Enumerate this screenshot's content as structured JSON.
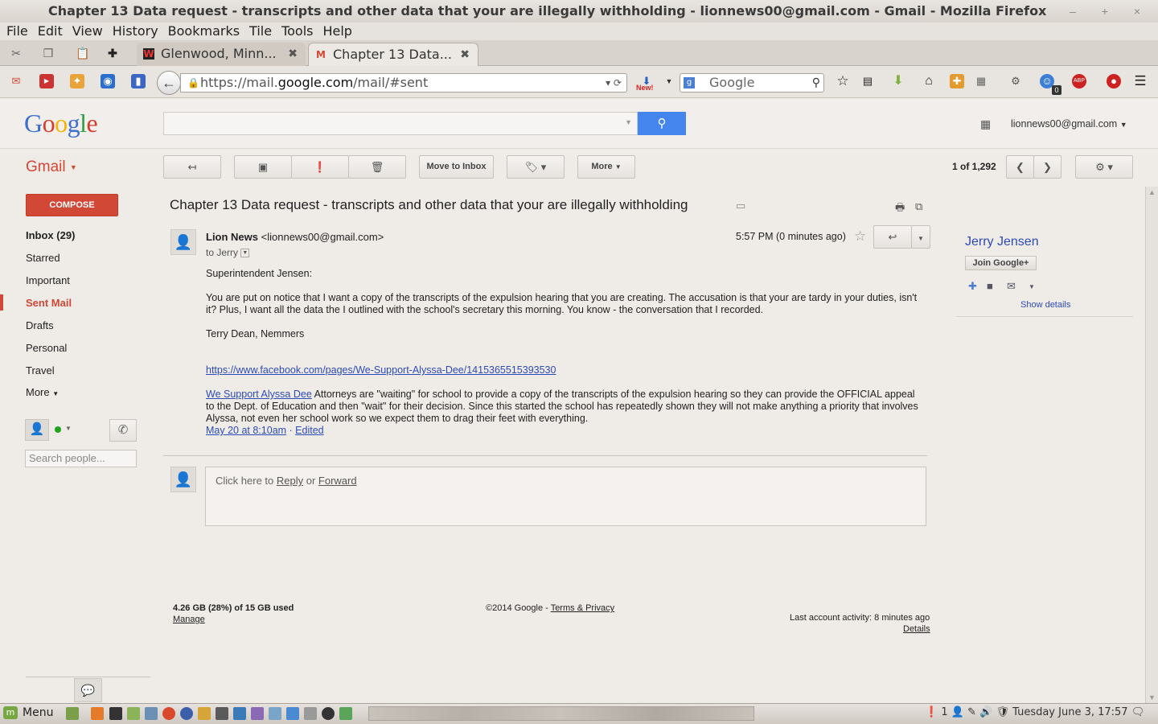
{
  "window": {
    "title": "Chapter 13 Data request - transcripts and other data that your are illegally withholding - lionnews00@gmail.com - Gmail - Mozilla Firefox",
    "controls": "– + ×"
  },
  "menubar": [
    "File",
    "Edit",
    "View",
    "History",
    "Bookmarks",
    "Tile",
    "Tools",
    "Help"
  ],
  "tabs": [
    {
      "label": "Glenwood, Minn...",
      "icon": "W"
    },
    {
      "label": "Chapter 13 Data...",
      "icon": "M"
    }
  ],
  "browser": {
    "url_prefix": "https://mail.",
    "url_domain": "google.com",
    "url_suffix": "/mail/#sent",
    "search_placeholder": "Google",
    "download_badge": "New!",
    "notif_count": "0"
  },
  "gmail": {
    "logo": [
      "G",
      "o",
      "o",
      "g",
      "l",
      "e"
    ],
    "logo_colors": [
      "#3c6fcf",
      "#d23f31",
      "#f4b400",
      "#3c6fcf",
      "#2f9e44",
      "#d23f31"
    ],
    "account": "lionnews00@gmail.com",
    "brand": "Gmail",
    "toolbar": {
      "move_to_inbox": "Move to Inbox",
      "more": "More",
      "pager": "1 of 1,292"
    },
    "compose": "COMPOSE",
    "nav": [
      {
        "label": "Inbox (29)",
        "bold": true
      },
      {
        "label": "Starred"
      },
      {
        "label": "Important"
      },
      {
        "label": "Sent Mail",
        "active": true
      },
      {
        "label": "Drafts"
      },
      {
        "label": "Personal"
      },
      {
        "label": "Travel"
      },
      {
        "label": "More"
      }
    ],
    "search_people_placeholder": "Search people...",
    "accent_color": "#d14836"
  },
  "message": {
    "subject": "Chapter 13 Data request - transcripts and other data that your are illegally withholding",
    "sender_name": "Lion News",
    "sender_email": "<lionnews00@gmail.com>",
    "to": "to Jerry",
    "time": "5:57 PM (0 minutes ago)",
    "greeting": "Superintendent Jensen:",
    "para1": "You are put on notice that I want a copy of the transcripts of the expulsion hearing that you are creating. The accusation is that your are tardy in your duties, isn't it? Plus, I want all the data the I outlined with the school's secretary this morning. You know - the conversation that I recorded.",
    "signature": "Terry Dean, Nemmers",
    "fb_link": "https://www.facebook.com/pages/We-Support-Alyssa-Dee/1415365515393530",
    "quote_link": "We Support Alyssa Dee",
    "quote_text": " Attorneys are \"waiting\" for school to provide a copy of the transcripts of the expulsion hearing so they can provide the OFFICIAL appeal to the Dept. of Education and then \"wait\" for their decision. Since this started the school has repeatedly shown they will not make anything a priority that involves Alyssa, not even her school work so we expect them to drag their feet with everything.",
    "quote_date": "May 20 at 8:10am",
    "quote_sep": " · ",
    "quote_edited": "Edited"
  },
  "reply": {
    "prefix": "Click here to ",
    "reply": "Reply",
    "or": " or ",
    "forward": "Forward"
  },
  "footer": {
    "storage": "4.26 GB (28%) of 15 GB used",
    "manage": "Manage",
    "copyright": "©2014 Google - ",
    "terms": "Terms & Privacy",
    "activity": "Last account activity: 8 minutes ago",
    "details": "Details"
  },
  "contact": {
    "name": "Jerry Jensen",
    "join": "Join Google+",
    "show_details": "Show details"
  },
  "taskbar": {
    "menu": "Menu",
    "tray_count": "1",
    "clock": "Tuesday June  3, 17:57"
  }
}
